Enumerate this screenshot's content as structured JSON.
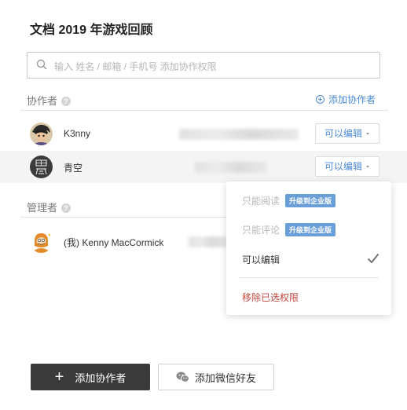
{
  "title": "文档 2019 年游戏回顾",
  "search": {
    "placeholder": "输入 姓名 / 邮箱 / 手机号 添加协作权限"
  },
  "collaborators": {
    "label": "协作者",
    "help": "?",
    "add_link": "添加协作者",
    "items": [
      {
        "name": "K3nny",
        "permission": "可以编辑"
      },
      {
        "name": "青空",
        "permission": "可以编辑"
      }
    ]
  },
  "managers": {
    "label": "管理者",
    "help": "?",
    "items": [
      {
        "name": "(我) Kenny MacCormick"
      }
    ]
  },
  "dropdown": {
    "options": [
      {
        "label": "只能阅读",
        "badge": "升级到企业版",
        "disabled": true
      },
      {
        "label": "只能评论",
        "badge": "升级到企业版",
        "disabled": true
      },
      {
        "label": "可以编辑",
        "selected": true
      }
    ],
    "remove": "移除已选权限"
  },
  "buttons": {
    "add_collaborator_icon": "+",
    "add_collaborator": "添加协作者",
    "add_wechat": "添加微信好友"
  },
  "colors": {
    "accent": "#4a8ad8",
    "danger": "#c4463b",
    "primary_button": "#3a3a3a",
    "badge": "#6a9ed9"
  }
}
